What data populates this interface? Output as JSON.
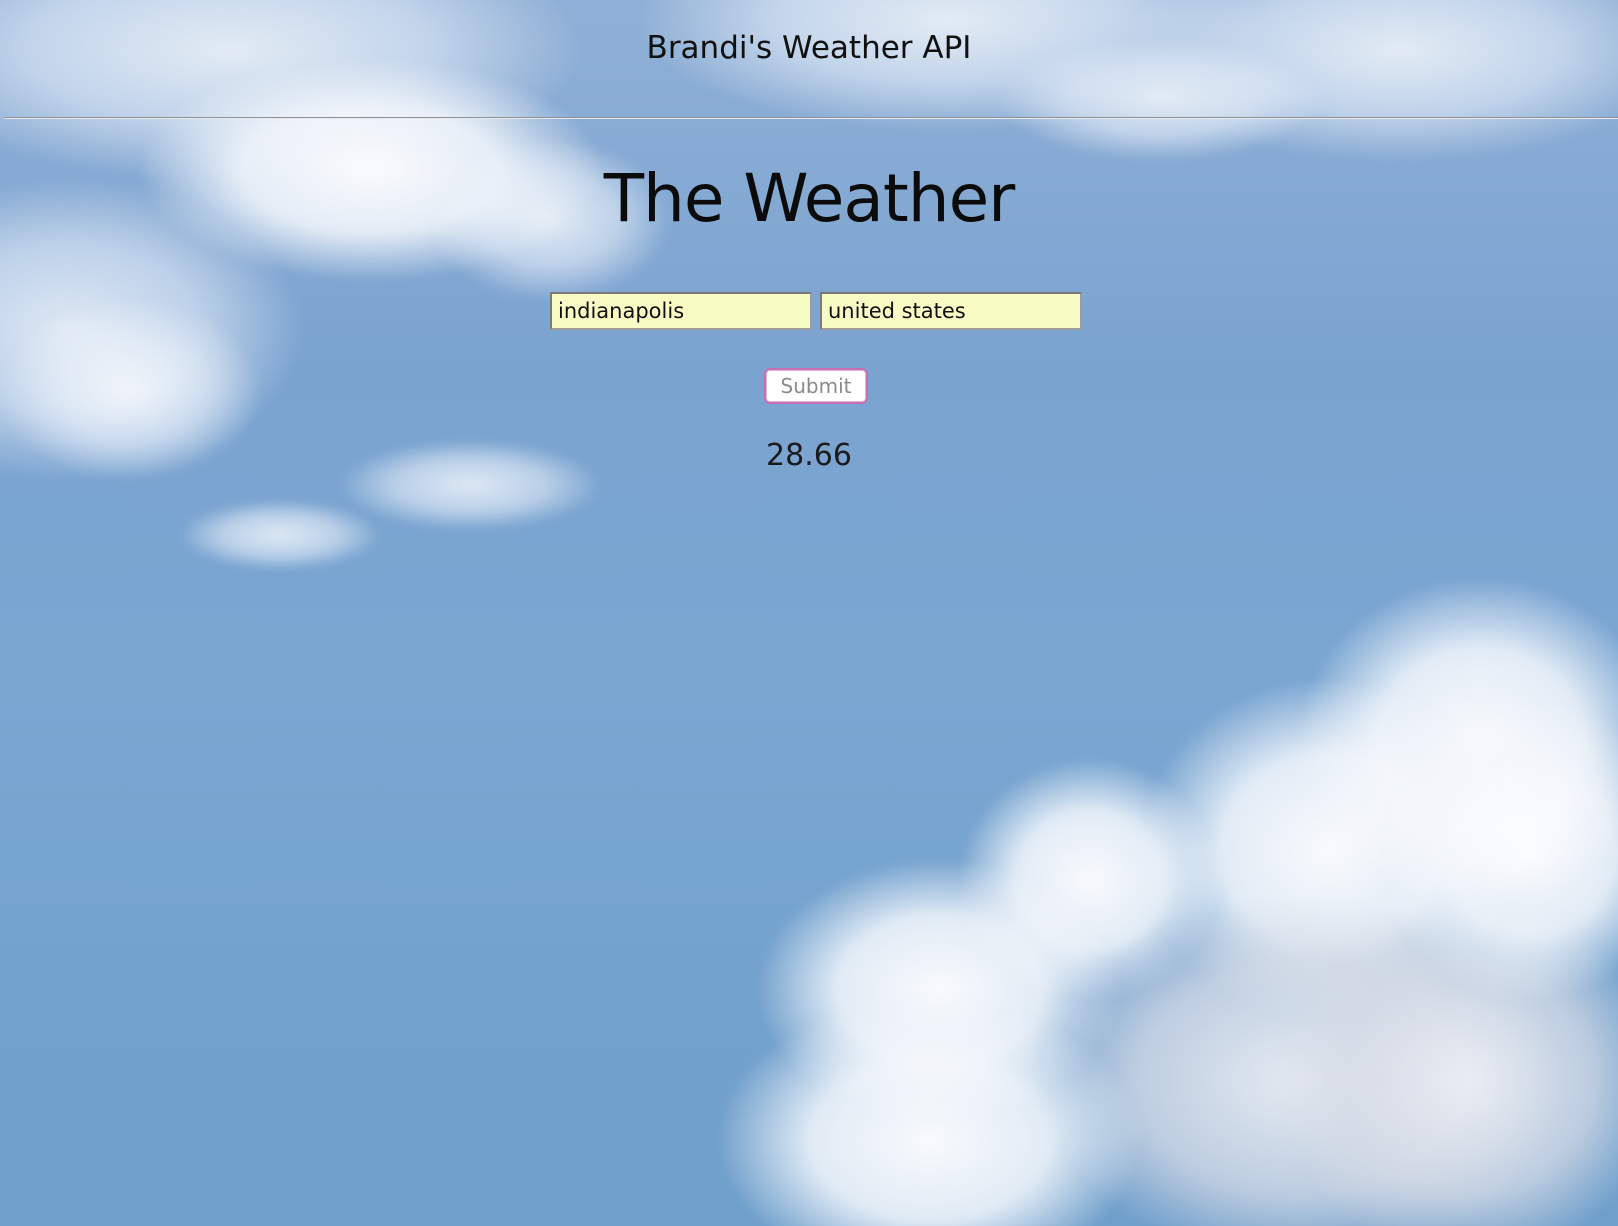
{
  "header": {
    "site_title": "Brandi's Weather API"
  },
  "main": {
    "heading": "The Weather",
    "city_input": {
      "value": "indianapolis"
    },
    "country_input": {
      "value": "united states"
    },
    "submit_label": "Submit",
    "result": "28.66"
  },
  "background": {
    "type": "sky-with-clouds-image",
    "sky_color": "#7aa6d2",
    "cloud_color": "#ffffff"
  },
  "colors": {
    "input_background": "#f8fbc4",
    "button_border": "#c76fb5",
    "button_text": "#8a8a8a",
    "text": "#111111"
  }
}
